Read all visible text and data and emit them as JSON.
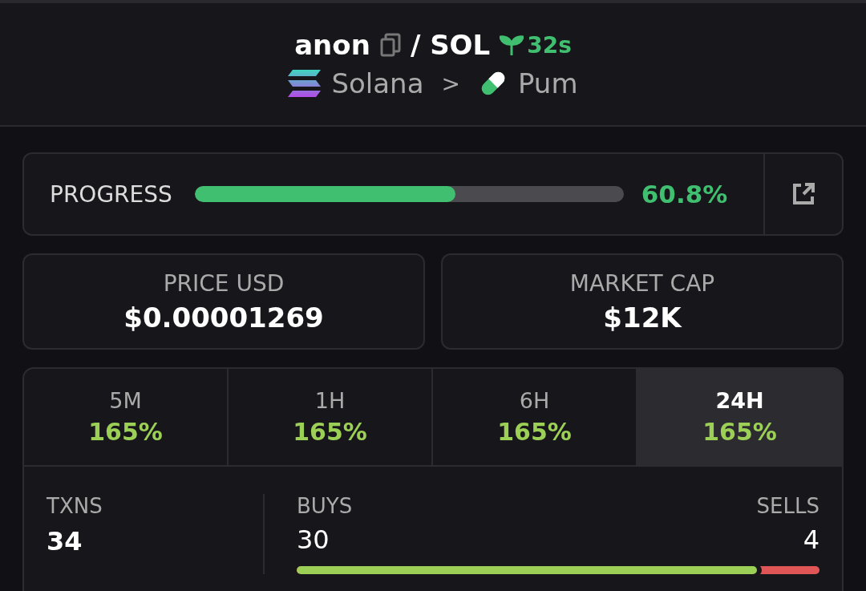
{
  "header": {
    "token": "anon",
    "pair": "/ SOL",
    "age": "32s",
    "chain": "Solana",
    "separator": ">",
    "platform": "Pum"
  },
  "progress": {
    "label": "PROGRESS",
    "level": 0.608,
    "reading": "60.8%"
  },
  "stats": [
    {
      "label": "PRICE USD",
      "value": "$0.00001269"
    },
    {
      "label": "MARKET CAP",
      "value": "$12K"
    }
  ],
  "periods": [
    {
      "label": "5M",
      "change": "165%",
      "selected": false
    },
    {
      "label": "1H",
      "change": "165%",
      "selected": false
    },
    {
      "label": "6H",
      "change": "165%",
      "selected": false
    },
    {
      "label": "24H",
      "change": "165%",
      "selected": true
    }
  ],
  "txns": {
    "label": "TXNS",
    "value": "34",
    "buys_label": "BUYS",
    "buys": "30",
    "sells_label": "SELLS",
    "sells": "4",
    "level": 0.88
  }
}
